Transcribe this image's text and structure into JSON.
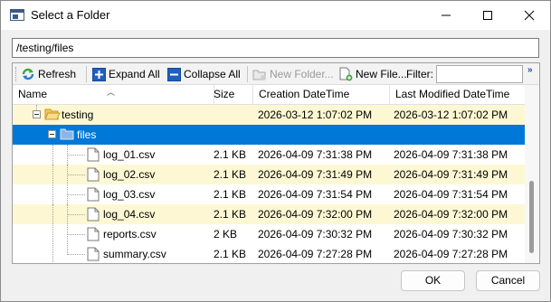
{
  "window": {
    "title": "Select a Folder"
  },
  "path": {
    "value": "/testing/files"
  },
  "toolbar": {
    "refresh": "Refresh",
    "expand_all": "Expand All",
    "collapse_all": "Collapse All",
    "new_folder": "New Folder...",
    "new_file": "New File...",
    "filter_label": "Filter:",
    "filter_value": "",
    "overflow": "»"
  },
  "columns": {
    "name": "Name",
    "size": "Size",
    "created": "Creation DateTime",
    "modified": "Last Modified DateTime"
  },
  "rows": [
    {
      "name": "testing",
      "size": "",
      "created": "2026-03-12 1:07:02 PM",
      "modified": "2026-03-12 1:07:02 PM",
      "type": "folder"
    },
    {
      "name": "files",
      "size": "",
      "created": "",
      "modified": "",
      "type": "folder",
      "selected": true
    },
    {
      "name": "log_01.csv",
      "size": "2.1 KB",
      "created": "2026-04-09 7:31:38 PM",
      "modified": "2026-04-09 7:31:38 PM",
      "type": "file"
    },
    {
      "name": "log_02.csv",
      "size": "2.1 KB",
      "created": "2026-04-09 7:31:49 PM",
      "modified": "2026-04-09 7:31:49 PM",
      "type": "file"
    },
    {
      "name": "log_03.csv",
      "size": "2.1 KB",
      "created": "2026-04-09 7:31:54 PM",
      "modified": "2026-04-09 7:31:54 PM",
      "type": "file"
    },
    {
      "name": "log_04.csv",
      "size": "2.1 KB",
      "created": "2026-04-09 7:32:00 PM",
      "modified": "2026-04-09 7:32:00 PM",
      "type": "file"
    },
    {
      "name": "reports.csv",
      "size": "2 KB",
      "created": "2026-04-09 7:30:32 PM",
      "modified": "2026-04-09 7:30:32 PM",
      "type": "file"
    },
    {
      "name": "summary.csv",
      "size": "2.1 KB",
      "created": "2026-04-09 7:27:28 PM",
      "modified": "2026-04-09 7:27:28 PM",
      "type": "file"
    }
  ],
  "buttons": {
    "ok": "OK",
    "cancel": "Cancel"
  },
  "colors": {
    "selection": "#0078d7",
    "alt_row": "#fdf8d3",
    "folder": "#f4c55a"
  }
}
